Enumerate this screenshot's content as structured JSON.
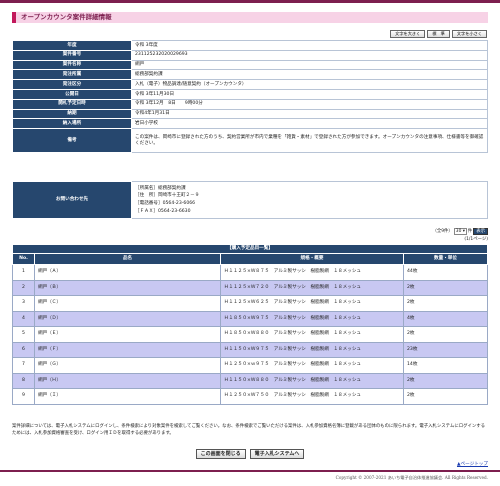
{
  "title": "オープンカウンタ案件詳細情報",
  "font_controls": [
    "文字を大きく",
    "標　準",
    "文字を小さく"
  ],
  "info_rows": [
    {
      "label": "年度",
      "value": "令和 3年度"
    },
    {
      "label": "案件番号",
      "value": "231125232020029693"
    },
    {
      "label": "案件名称",
      "value": "網戸"
    },
    {
      "label": "発注所属",
      "value": "総務部契約課"
    },
    {
      "label": "発注区分",
      "value": "入札（電子）物品調達/随意契約（オープンカウンタ）"
    },
    {
      "label": "公開日",
      "value": "令和 3年11月30日"
    },
    {
      "label": "開札予定日時",
      "value": "令和 3年12月　8日　　9時00分"
    },
    {
      "label": "納期",
      "value": "令和4年1月31日"
    },
    {
      "label": "納入場所",
      "value": "岩日小学校"
    },
    {
      "label": "備考",
      "value": "この案件は、岡崎市に登録された方のうち、契約営業所が市内で業種を「雑貨・素材」で登録された方が参加できます。オープンカウンタの注意事項、仕様書等を御確認ください。"
    }
  ],
  "contact": {
    "label": "お問い合わせ先",
    "lines": [
      "［所属名］総務部契約課",
      "［住　所］岡崎市十王町２－９",
      "［電話番号］0564-23-6066",
      "［ＦＡＸ］0564-23-6630"
    ]
  },
  "pager": {
    "total_label": "（全9件）",
    "per_page": "30",
    "per_page_suffix": "件",
    "go_label": "表示",
    "page_info": "1/1ページ"
  },
  "list": {
    "caption": "【購入予定品目一覧】",
    "headers": [
      "No.",
      "品名",
      "規格・概要",
      "数量・単位"
    ],
    "rows": [
      [
        "1",
        "網戸（Ａ）",
        "Ｈ１１２５×Ｗ８７５　アルミ製サッシ　樹脂製網　１８メッシュ",
        "44枚"
      ],
      [
        "2",
        "網戸（Ｂ）",
        "Ｈ１１２５×Ｗ７２０　アルミ製サッシ　樹脂製網　１８メッシュ",
        "2枚"
      ],
      [
        "3",
        "網戸（Ｃ）",
        "Ｈ１１２５×Ｗ６２５　アルミ製サッシ　樹脂製網　１８メッシュ",
        "2枚"
      ],
      [
        "4",
        "網戸（Ｄ）",
        "Ｈ１８５０×Ｗ９７５　アルミ製サッシ　樹脂製網　１８メッシュ",
        "4枚"
      ],
      [
        "5",
        "網戸（Ｅ）",
        "Ｈ１８５０×Ｗ８８０　アルミ製サッシ　樹脂製網　１８メッシュ",
        "2枚"
      ],
      [
        "6",
        "網戸（Ｆ）",
        "Ｈ１１５０×Ｗ９７５　アルミ製サッシ　樹脂製網　１８メッシュ",
        "23枚"
      ],
      [
        "7",
        "網戸（Ｇ）",
        "Ｈ１２５０×ｗ９７５　アルミ製サッシ　樹脂製網　１８メッシュ",
        "14枚"
      ],
      [
        "8",
        "網戸（Ｈ）",
        "Ｈ１１５０×Ｗ８８０　アルミ製サッシ　樹脂製網　１８メッシュ",
        "2枚"
      ],
      [
        "9",
        "網戸（Ｉ）",
        "Ｈ１２５０×Ｗ７５０　アルミ製サッシ　樹脂製網　１８メッシュ",
        "2枚"
      ]
    ]
  },
  "notice": "案件詳細については、電子入札システムにログインし、条件検索により対象案件を検索してご覧ください。なお、条件検索でご覧いただける案件は、入札参加資格名簿に登載がある団体のものに限られます。電子入札システムにログインするためには、入札参加資格審査を受け、ログイン用ＩＤを取得する必要があります。",
  "buttons": {
    "close": "この画面を閉じる",
    "ebid": "電子入札システムへ"
  },
  "page_top": "▲ページトップ",
  "copyright": "Copyright © 2007-2021 あいち電子自治体推進協議会. All Rights Reserved.",
  "colors": {
    "accent": "#7d1f4f",
    "title_bg": "#f7d2e6",
    "header_bg": "#26476e",
    "row_alt": "#c8c8f2"
  }
}
